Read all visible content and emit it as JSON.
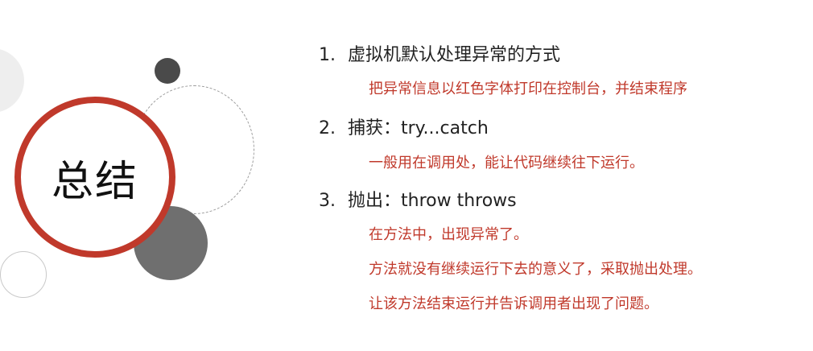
{
  "slide": {
    "title": "总结",
    "items": [
      {
        "number": "1.",
        "heading": "虚拟机默认处理异常的方式",
        "notes": [
          "把异常信息以红色字体打印在控制台，并结束程序"
        ]
      },
      {
        "number": "2.",
        "heading": "捕获：try...catch",
        "notes": [
          "一般用在调用处，能让代码继续往下运行。"
        ]
      },
      {
        "number": "3.",
        "heading": "抛出：throw throws",
        "notes": [
          "在方法中，出现异常了。",
          "方法就没有继续运行下去的意义了，采取抛出处理。",
          "让该方法结束运行并告诉调用者出现了问题。"
        ]
      }
    ]
  },
  "colors": {
    "accent_red": "#c0392b",
    "text_dark": "#222222",
    "circle_dark": "#4a4a4a",
    "circle_grey": "#6f6f6f"
  }
}
